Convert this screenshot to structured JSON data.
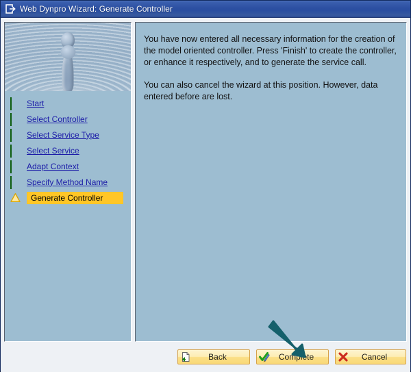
{
  "window": {
    "title": "Web Dynpro Wizard: Generate Controller",
    "title_icon": "exit-box-arrow-icon"
  },
  "sidebar": {
    "banner_icon": "water-droplet-splash-image",
    "steps": [
      {
        "label": "Start",
        "state": "done",
        "icon": "green-sphere-icon"
      },
      {
        "label": "Select Controller",
        "state": "done",
        "icon": "green-sphere-icon"
      },
      {
        "label": "Select Service Type",
        "state": "done",
        "icon": "green-sphere-icon"
      },
      {
        "label": "Select Service",
        "state": "done",
        "icon": "green-sphere-icon"
      },
      {
        "label": "Adapt Context",
        "state": "done",
        "icon": "green-sphere-icon"
      },
      {
        "label": "Specify Method Name",
        "state": "done",
        "icon": "green-sphere-icon"
      },
      {
        "label": "Generate Controller",
        "state": "current",
        "icon": "warning-triangle-icon"
      }
    ]
  },
  "content": {
    "paragraph1": "You have now entered all necessary information for the creation of the model oriented controller. Press 'Finish' to create the controller, or enhance it respectively, and to generate the service call.",
    "paragraph2": "You can also cancel the wizard at this position. However, data entered before are lost."
  },
  "footer": {
    "buttons": [
      {
        "label": "Back",
        "icon": "page-back-arrow-icon"
      },
      {
        "label": "Complete",
        "icon": "green-check-pencil-icon"
      },
      {
        "label": "Cancel",
        "icon": "red-x-icon"
      }
    ]
  },
  "annotation": {
    "arrow_icon": "teal-pointer-arrow",
    "arrow_color": "#15606b",
    "points_at": "Complete"
  },
  "colors": {
    "titlebar_blue": "#2d50a2",
    "panel_blue": "#9dbdd1",
    "window_gray": "#eef1f5",
    "link_blue": "#1c1ca8",
    "highlight_yellow": "#ffc627",
    "button_yellow": "#fdedb4",
    "green_bullet": "#17a917",
    "red_x": "#cc2a1e"
  }
}
